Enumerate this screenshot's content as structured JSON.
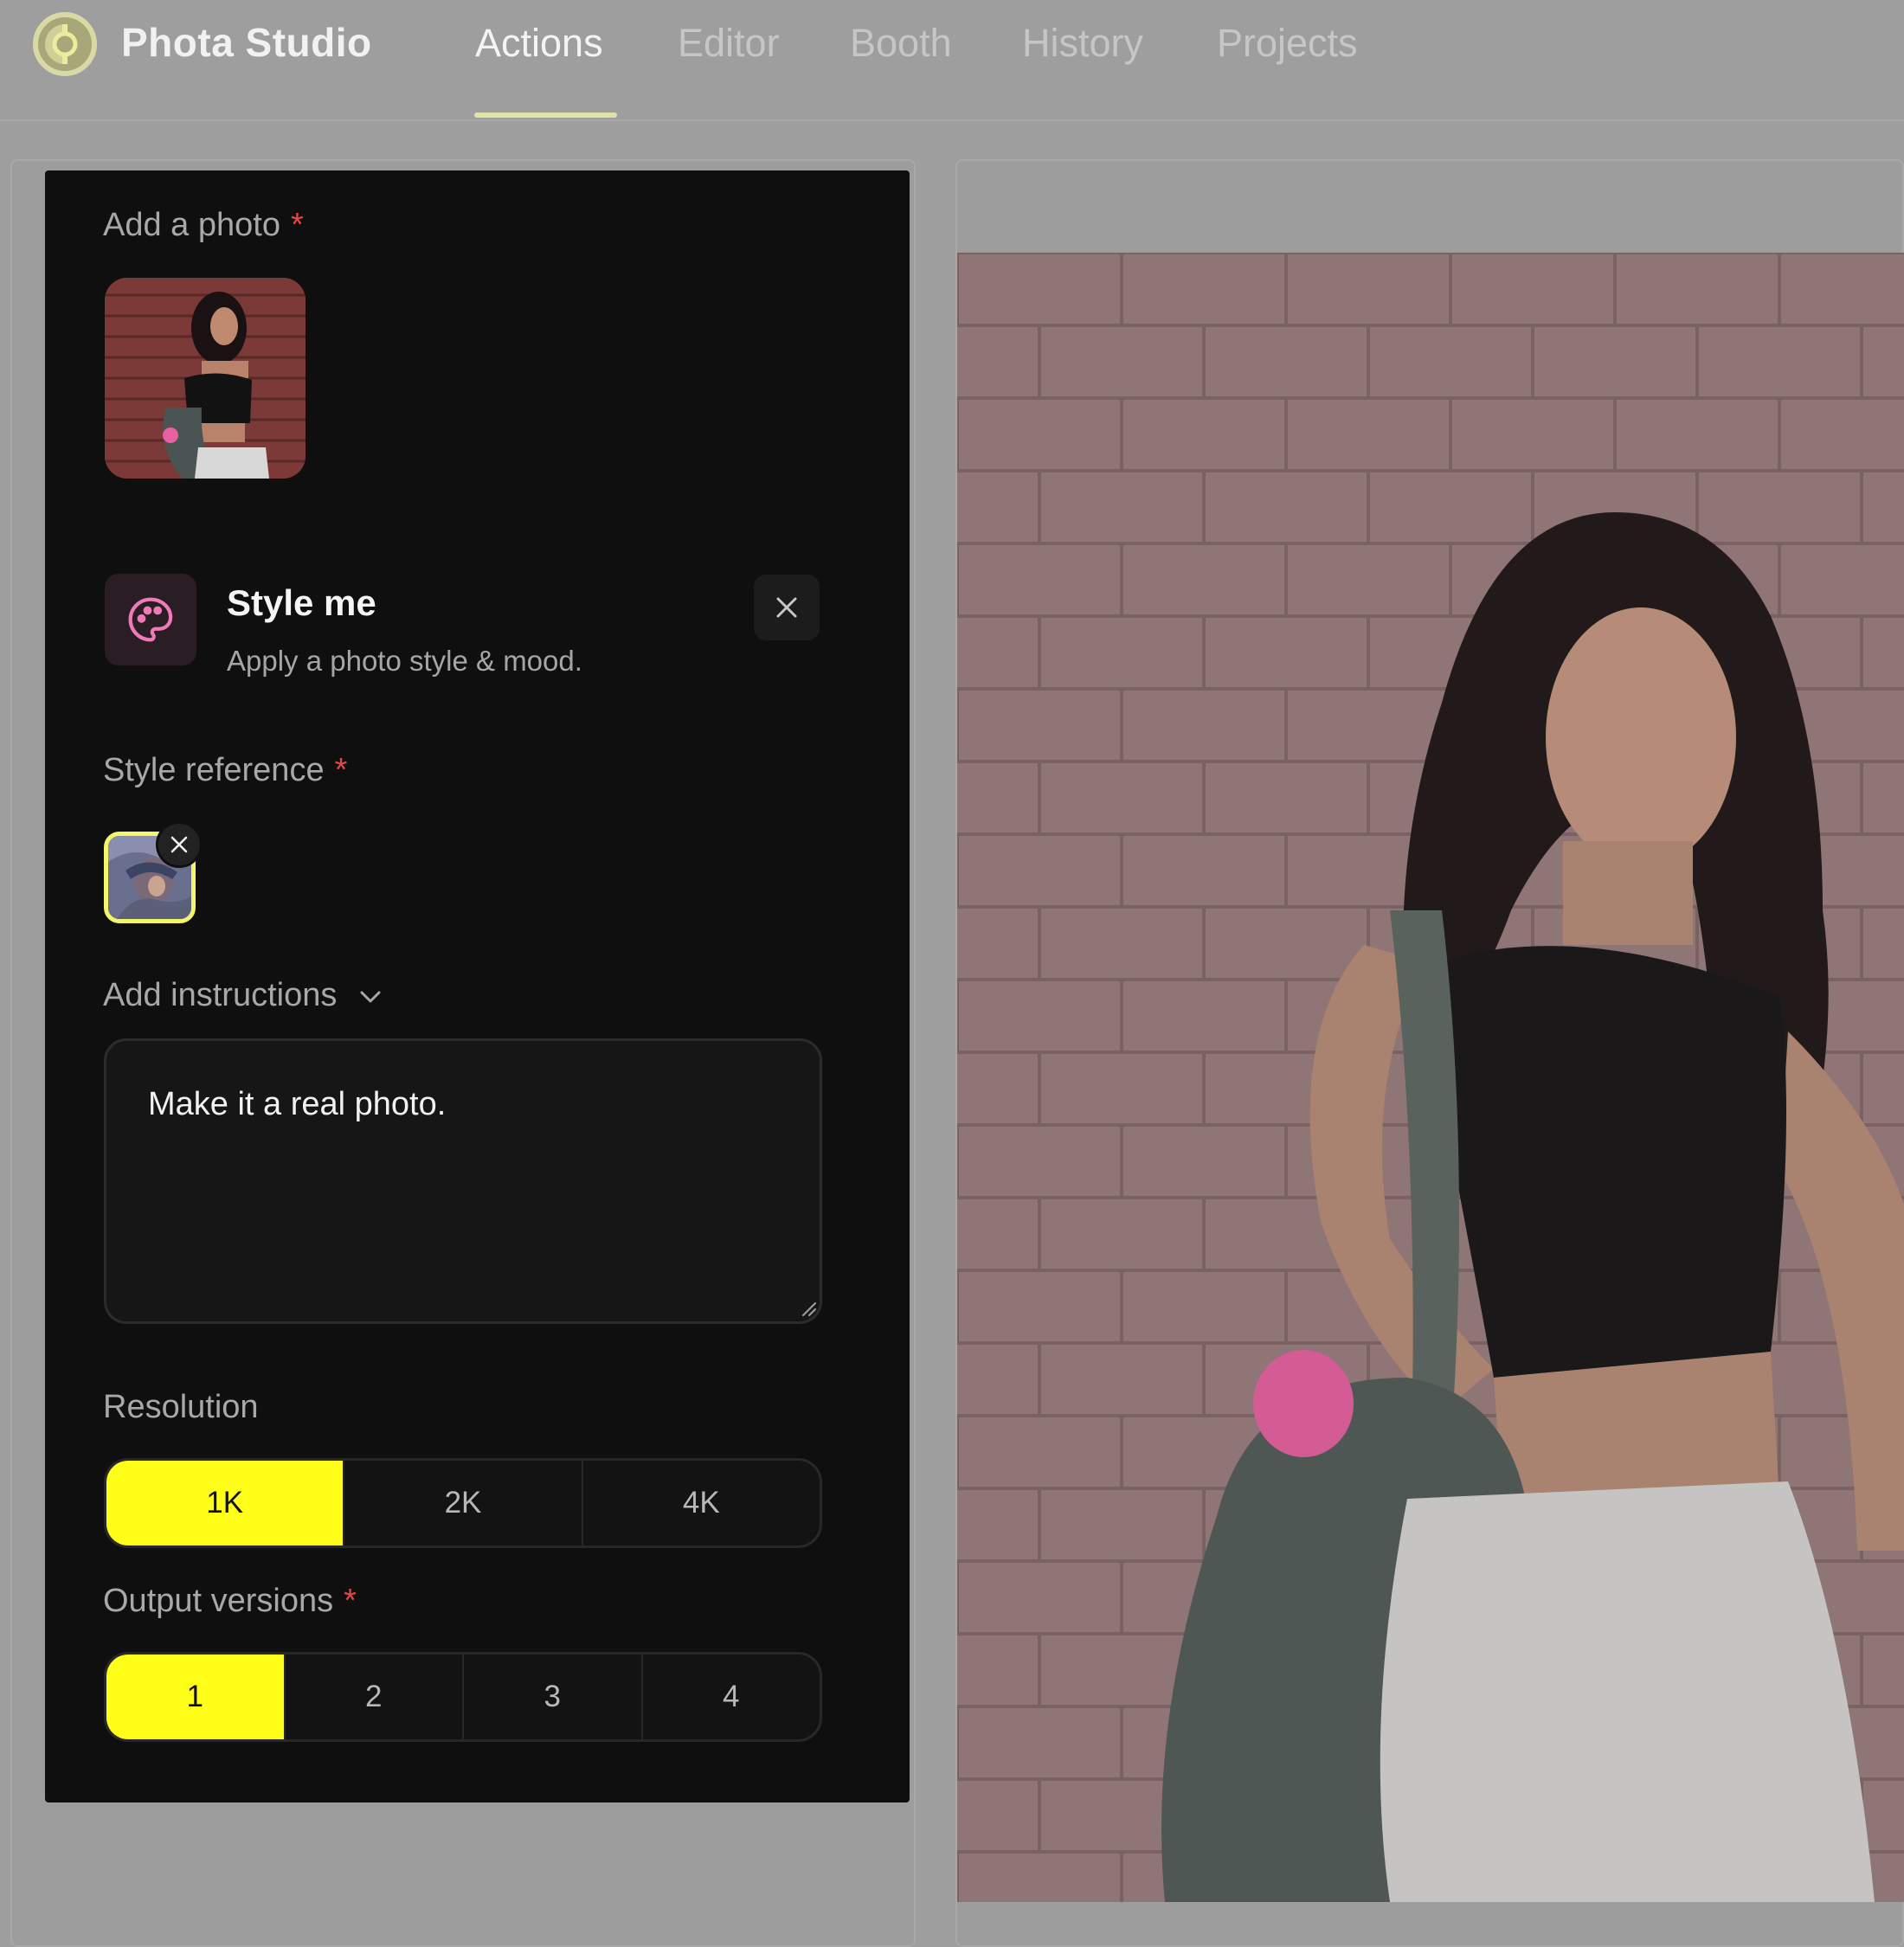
{
  "header": {
    "app_title": "Phota Studio",
    "tabs": [
      {
        "label": "Actions",
        "active": true
      },
      {
        "label": "Editor"
      },
      {
        "label": "Booth"
      },
      {
        "label": "History"
      },
      {
        "label": "Projects"
      }
    ]
  },
  "panel": {
    "add_photo_label": "Add a photo",
    "required_mark": "*",
    "action": {
      "title": "Style me",
      "subtitle": "Apply a photo style & mood.",
      "icon": "palette-icon"
    },
    "style_reference_label": "Style reference",
    "instructions_label": "Add instructions",
    "instructions_value": "Make it a real photo.",
    "resolution_label": "Resolution",
    "resolution_options": [
      "1K",
      "2K",
      "4K"
    ],
    "resolution_selected": "1K",
    "output_label": "Output versions",
    "output_options": [
      "1",
      "2",
      "3",
      "4"
    ],
    "output_selected": "1"
  },
  "colors": {
    "accent": "#ffff1a",
    "required": "#e04848",
    "panel_bg": "#0f0f0f",
    "icon_pink": "#f07ab8"
  }
}
